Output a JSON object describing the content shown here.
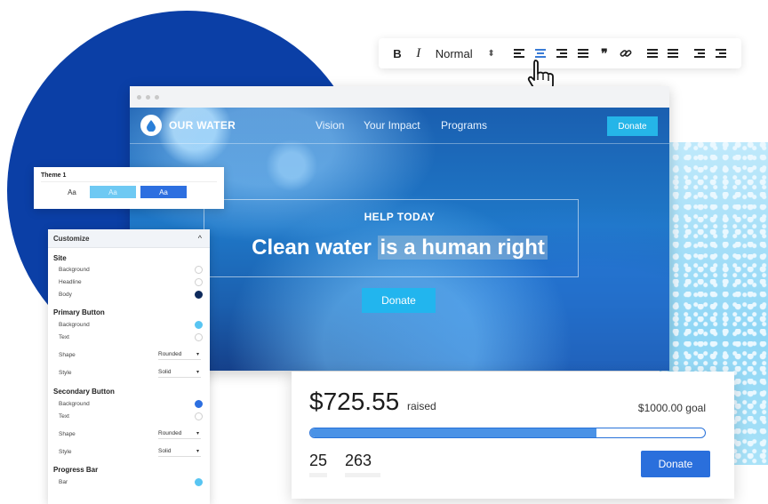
{
  "toolbar": {
    "bold_label": "B",
    "italic_label": "I",
    "format_label": "Normal",
    "format_arrows": "⬍",
    "icons": [
      "align-left-icon",
      "align-center-icon",
      "align-right-icon",
      "align-justify-icon",
      "blockquote-icon",
      "link-icon",
      "ordered-list-icon",
      "bullet-list-icon",
      "outdent-icon",
      "indent-icon"
    ],
    "quote_glyph": "❞",
    "link_glyph": "🔗"
  },
  "site": {
    "logo_text": "OUR WATER",
    "nav": [
      "Vision",
      "Your Impact",
      "Programs"
    ],
    "nav_donate": "Donate",
    "eyebrow": "HELP TODAY",
    "headline_plain": "Clean water ",
    "headline_highlight": "is a human right",
    "hero_donate": "Donate"
  },
  "theme": {
    "title": "Theme 1",
    "swatch_1": "Aa",
    "swatch_2": "Aa",
    "swatch_3": "Aa"
  },
  "customize": {
    "title": "Customize",
    "caret": "^",
    "site_section": "Site",
    "site_rows": [
      "Background",
      "Headline",
      "Body"
    ],
    "primary_section": "Primary Button",
    "primary_rows": [
      "Background",
      "Text",
      "Shape",
      "Style"
    ],
    "primary_shape": "Rounded",
    "primary_style": "Solid",
    "secondary_section": "Secondary Button",
    "secondary_rows": [
      "Background",
      "Text",
      "Shape",
      "Style"
    ],
    "secondary_shape": "Rounded",
    "secondary_style": "Solid",
    "progress_section": "Progress Bar",
    "progress_rows": [
      "Bar"
    ]
  },
  "fund": {
    "amount": "$725.55",
    "raised_label": "raised",
    "goal": "$1000.00 goal",
    "progress_fraction": 0.7256,
    "stat_1": "25",
    "stat_2": "263",
    "donate": "Donate"
  },
  "colors": {
    "brand_blue": "#0b3fa6",
    "accent_cyan": "#25b5e8",
    "button_blue": "#2a6fdc",
    "swatch_light": "#6ec9f3",
    "swatch_dark": "#2d6fe0",
    "site_body_dot": "#0e2a5c",
    "primary_bg_dot": "#58c5f2",
    "secondary_bg_dot": "#2d6fe0",
    "progress_dot": "#58c5f2"
  }
}
